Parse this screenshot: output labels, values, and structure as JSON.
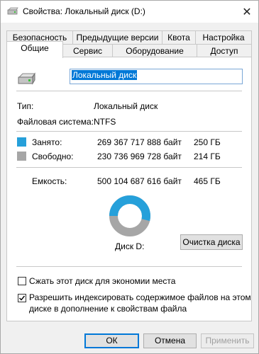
{
  "window": {
    "title": "Свойства: Локальный диск (D:)",
    "close_glyph": "✕"
  },
  "tabs": {
    "row1": [
      "Безопасность",
      "Предыдущие версии",
      "Квота",
      "Настройка"
    ],
    "row2": [
      "Общие",
      "Сервис",
      "Оборудование",
      "Доступ"
    ],
    "active": "Общие"
  },
  "general": {
    "drive_name": "Локальный диск",
    "type_label": "Тип:",
    "type_value": "Локальный диск",
    "fs_label": "Файловая система:",
    "fs_value": "NTFS",
    "used": {
      "label": "Занято:",
      "bytes": "269 367 717 888 байт",
      "size": "250 ГБ",
      "color": "#26a0da"
    },
    "free": {
      "label": "Свободно:",
      "bytes": "230 736 969 728 байт",
      "size": "214 ГБ",
      "color": "#a6a6a6"
    },
    "capacity": {
      "label": "Емкость:",
      "bytes": "500 104 687 616 байт",
      "size": "465 ГБ"
    },
    "used_fraction": 0.5386,
    "disk_label": "Диск D:",
    "cleanup_button": "Очистка диска",
    "compress_checkbox": {
      "label": "Сжать этот диск для экономии места",
      "checked": false
    },
    "index_checkbox": {
      "line1": "Разрешить индексировать содержимое файлов на этом",
      "line2": "диске в дополнение к свойствам файла",
      "checked": true
    }
  },
  "buttons": {
    "ok": "ОК",
    "cancel": "Отмена",
    "apply": "Применить"
  },
  "icons": {
    "title": "drive-icon",
    "drive": "hard-drive-icon",
    "close": "close-icon",
    "check": "checkmark-icon"
  }
}
